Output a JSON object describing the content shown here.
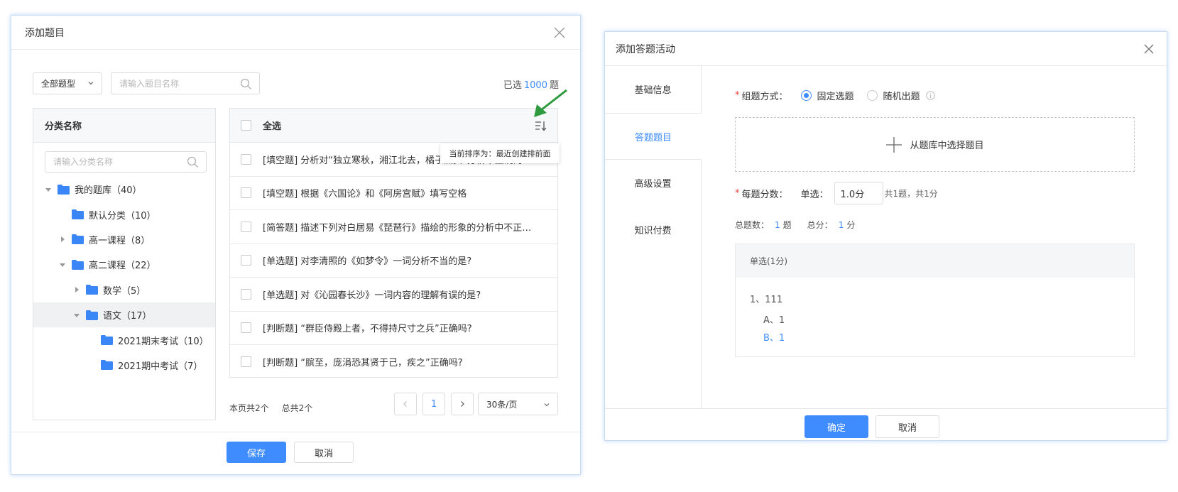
{
  "dialog_add_questions": {
    "title": "添加题目",
    "type_select": "全部题型",
    "search_placeholder": "请输入题目名称",
    "selected_prefix": "已选",
    "selected_count": "1000",
    "selected_suffix": "题",
    "category_header": "分类名称",
    "category_search_placeholder": "请输入分类名称",
    "tree": [
      {
        "label": "我的题库（40）"
      },
      {
        "label": "默认分类（10）"
      },
      {
        "label": "高一课程（8）"
      },
      {
        "label": "高二课程（22）"
      },
      {
        "label": "数学（5）"
      },
      {
        "label": "语文（17）"
      },
      {
        "label": "2021期末考试（10）"
      },
      {
        "label": "2021期中考试（7）"
      }
    ],
    "select_all": "全选",
    "sort_tooltip": "当前排序为：最近创建排前面",
    "questions": [
      "[填空题] 分析对“独立寒秋，湘江北去，橘子洲头”分析不正确的是？",
      "[填空题] 根据《六国论》和《阿房宫赋》填写空格",
      "[简答题] 描述下列对白居易《琵琶行》描绘的形象的分析中不正确的是？",
      "[单选题] 对李清照的《如梦令》一词分析不当的是?",
      "[单选题] 对《沁园春长沙》一词内容的理解有误的是?",
      "[判断题] “群臣侍殿上者，不得持尺寸之兵”正确吗?",
      "[判断题] “膑至，庞涓恐其贤于己，疾之”正确吗?"
    ],
    "page_count": "本页共2个",
    "total_count": "总共2个",
    "current_page": "1",
    "page_size": "30条/页",
    "save": "保存",
    "cancel": "取消"
  },
  "dialog_add_activity": {
    "title": "添加答题活动",
    "nav": [
      "基础信息",
      "答题题目",
      "高级设置",
      "知识付费"
    ],
    "compose_label": "组题方式：",
    "mode_fixed": "固定选题",
    "mode_random": "随机出题",
    "pick_from_bank": "从题库中选择题目",
    "score_label": "每题分数：",
    "single_label": "单选：",
    "single_score": "1.0分",
    "score_summary": "共1题，共1分",
    "total_q_label": "总题数：",
    "total_q_value": "1",
    "total_q_unit": "题",
    "total_score_label": "总分：",
    "total_score_value": "1",
    "total_score_unit": "分",
    "card_header": "单选(1分)",
    "question": "1、111",
    "option_a": "A、1",
    "option_b": "B、1",
    "confirm": "确定",
    "cancel": "取消"
  },
  "colors": {
    "accent": "#3f8cff",
    "folder": "#3a86f7",
    "annotation_arrow": "#2e9a3e",
    "required": "#e8443c"
  }
}
